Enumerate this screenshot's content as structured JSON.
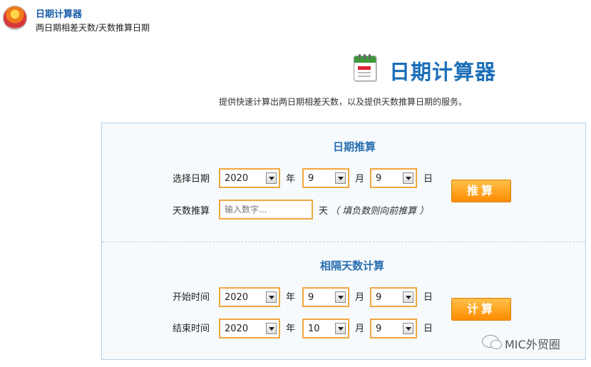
{
  "app": {
    "title": "日期计算器",
    "subtitle": "两日期相差天数/天数推算日期"
  },
  "page": {
    "title": "日期计算器",
    "description": "提供快速计算出两日期相差天数，以及提供天数推算日期的服务。"
  },
  "date_projection": {
    "section_title": "日期推算",
    "select_date_label": "选择日期",
    "year": "2020",
    "month": "9",
    "day": "9",
    "days_label": "天数推算",
    "days_placeholder": "输入数字...",
    "days_unit": "天",
    "days_hint": "（ 填负数则向前推算 ）",
    "button_label": "推算"
  },
  "interval": {
    "section_title": "相隔天数计算",
    "start_label": "开始时间",
    "start_year": "2020",
    "start_month": "9",
    "start_day": "9",
    "end_label": "结束时间",
    "end_year": "2020",
    "end_month": "10",
    "end_day": "9",
    "button_label": "计算"
  },
  "units": {
    "year": "年",
    "month": "月",
    "day": "日"
  },
  "watermark": {
    "text": "MIC外贸圈"
  }
}
